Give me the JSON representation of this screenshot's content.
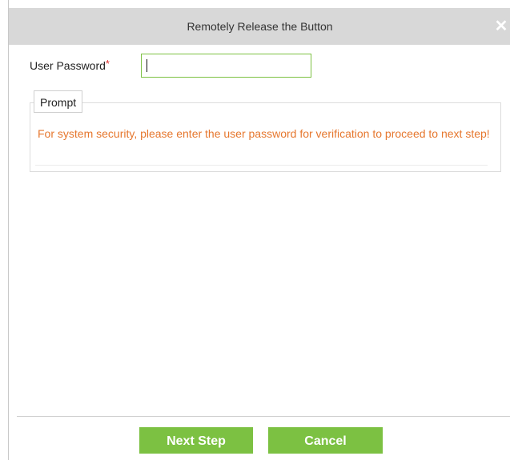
{
  "dialog": {
    "title": "Remotely Release the Button",
    "close_glyph": "✕"
  },
  "form": {
    "password_label": "User Password",
    "required_mark": "*",
    "password_value": ""
  },
  "prompt": {
    "legend": "Prompt",
    "message": "For system security, please enter the user password for verification to proceed to next step!"
  },
  "footer": {
    "next_label": "Next Step",
    "cancel_label": "Cancel"
  },
  "colors": {
    "accent_green": "#7cc142",
    "prompt_orange": "#e6772e",
    "required_red": "#e0312f",
    "titlebar_gray": "#d8d8d8"
  },
  "icons": {
    "close": "close-icon"
  }
}
